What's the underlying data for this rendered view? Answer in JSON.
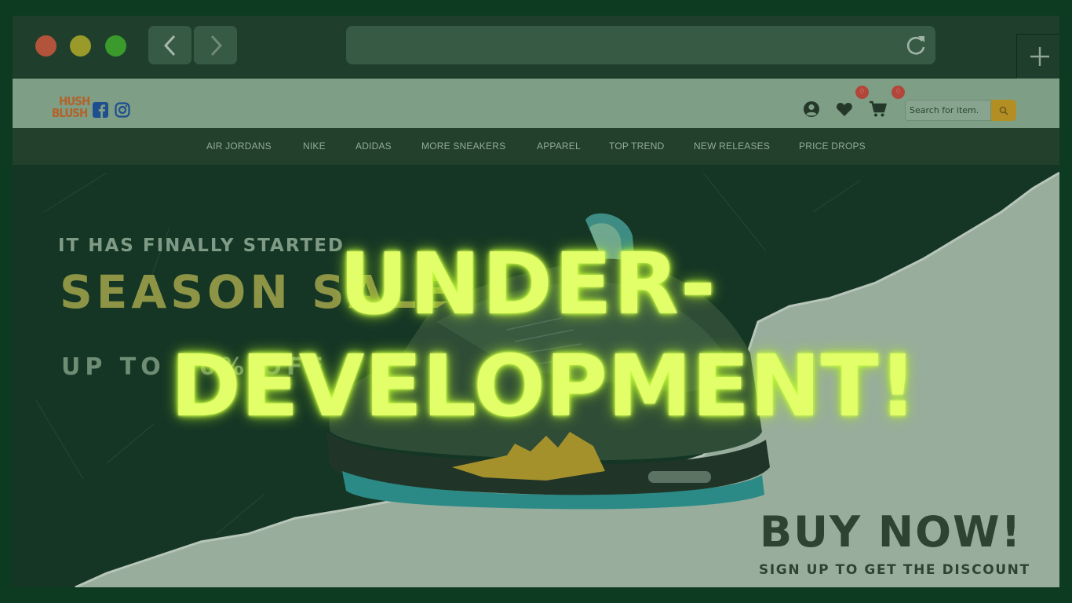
{
  "site": {
    "logo_top": "HUSH",
    "logo_bottom": "BLUSH",
    "search_placeholder": "Search for item.",
    "wishlist_count": "0",
    "cart_count": "0"
  },
  "nav": {
    "items": [
      "AIR JORDANS",
      "NIKE",
      "ADIDAS",
      "MORE SNEAKERS",
      "APPAREL",
      "TOP TREND",
      "NEW RELEASES",
      "PRICE DROPS"
    ]
  },
  "hero": {
    "kicker": "IT HAS FINALLY STARTED",
    "title": "SEASON SALE",
    "subtitle": "UP TO 50% OFF",
    "buy_now": "BUY NOW!",
    "signup": "SIGN UP TO GET THE DISCOUNT"
  },
  "overlay": {
    "line1": "UNDER-",
    "line2": "DEVELOPMENT!"
  },
  "colors": {
    "overlay_text": "#e2ff6a",
    "accent": "#b38f23",
    "badge": "#b3463a"
  },
  "icons": [
    "chevron-left-icon",
    "chevron-right-icon",
    "reload-icon",
    "plus-icon",
    "facebook-icon",
    "instagram-icon",
    "user-icon",
    "heart-icon",
    "cart-icon",
    "search-icon"
  ]
}
